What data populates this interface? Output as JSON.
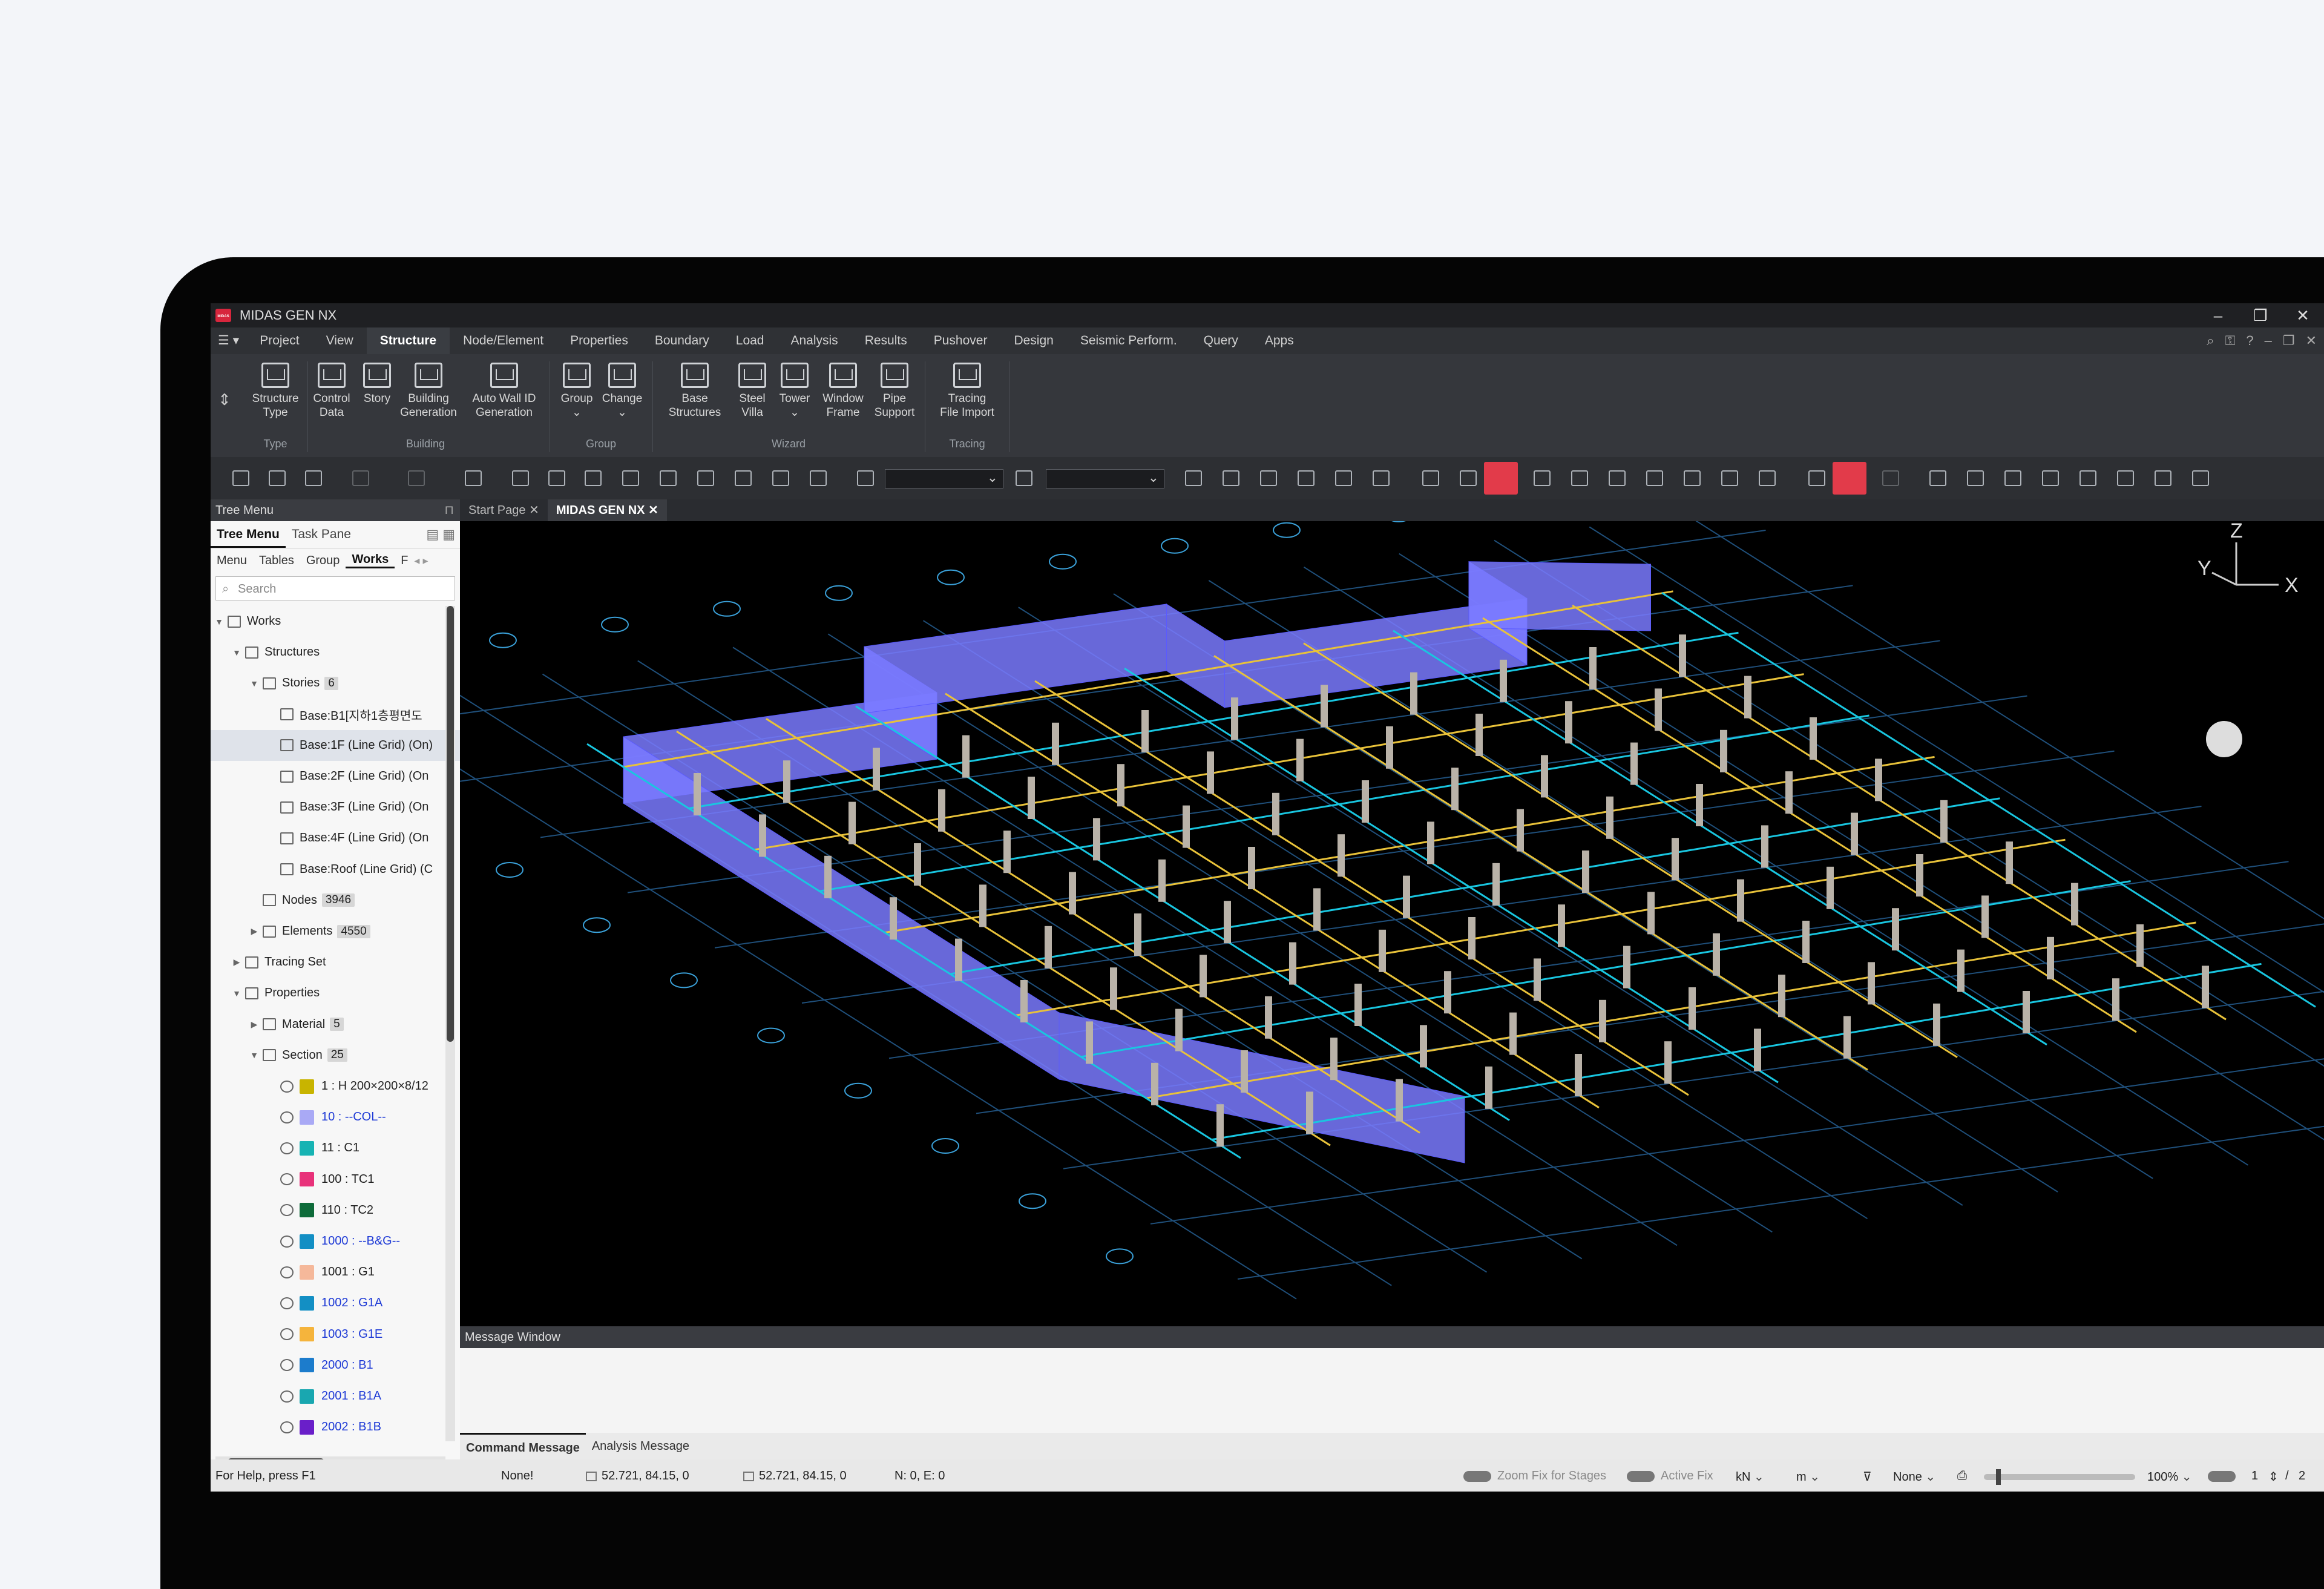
{
  "app": {
    "title": "MIDAS GEN NX",
    "logo_text": "MIDAS",
    "accent_color": "#e23b4a"
  },
  "menubar": {
    "items": [
      "Project",
      "View",
      "Structure",
      "Node/Element",
      "Properties",
      "Boundary",
      "Load",
      "Analysis",
      "Results",
      "Pushover",
      "Design",
      "Seismic Perform.",
      "Query",
      "Apps"
    ],
    "active": "Structure"
  },
  "ribbon": {
    "buttons": [
      {
        "label": "Structure\nType",
        "icon": "structure-type-icon"
      },
      {
        "label": "Control\nData",
        "icon": "control-data-icon"
      },
      {
        "label": "Story",
        "icon": "story-icon"
      },
      {
        "label": "Building\nGeneration",
        "icon": "building-generation-icon"
      },
      {
        "label": "Auto Wall ID\nGeneration",
        "icon": "auto-wall-id-icon"
      },
      {
        "label": "Group",
        "icon": "group-icon"
      },
      {
        "label": "Change",
        "icon": "change-icon"
      },
      {
        "label": "Base\nStructures",
        "icon": "base-structures-icon"
      },
      {
        "label": "Steel\nVilla",
        "icon": "steel-villa-icon"
      },
      {
        "label": "Tower",
        "icon": "tower-icon"
      },
      {
        "label": "Window\nFrame",
        "icon": "window-frame-icon"
      },
      {
        "label": "Pipe\nSupport",
        "icon": "pipe-support-icon"
      },
      {
        "label": "Tracing\nFile Import",
        "icon": "tracing-file-import-icon"
      }
    ],
    "groups": [
      "Type",
      "Building",
      "Group",
      "Wizard",
      "Tracing"
    ]
  },
  "tree_menu": {
    "header": "Tree Menu",
    "tabs": [
      "Tree Menu",
      "Task Pane"
    ],
    "subtabs": [
      "Menu",
      "Tables",
      "Group",
      "Works",
      "F"
    ],
    "active_subtab": "Works",
    "search_placeholder": "Search",
    "rows": [
      {
        "label": "Works",
        "indent": 0,
        "caret": "▼"
      },
      {
        "label": "Structures",
        "indent": 1,
        "caret": "▼"
      },
      {
        "label": "Stories",
        "indent": 2,
        "caret": "▼",
        "count": "6"
      },
      {
        "label": "Base:B1[지하1층평면도",
        "indent": 3
      },
      {
        "label": "Base:1F (Line Grid) (On)",
        "indent": 3,
        "selected": true
      },
      {
        "label": "Base:2F (Line Grid) (On",
        "indent": 3
      },
      {
        "label": "Base:3F (Line Grid) (On",
        "indent": 3
      },
      {
        "label": "Base:4F (Line Grid) (On",
        "indent": 3
      },
      {
        "label": "Base:Roof (Line Grid) (C",
        "indent": 3
      },
      {
        "label": "Nodes",
        "indent": 2,
        "count": "3946"
      },
      {
        "label": "Elements",
        "indent": 2,
        "caret": "▶",
        "count": "4550"
      },
      {
        "label": "Tracing Set",
        "indent": 1,
        "caret": "▶"
      },
      {
        "label": "Properties",
        "indent": 1,
        "caret": "▼"
      },
      {
        "label": "Material",
        "indent": 2,
        "caret": "▶",
        "count": "5"
      },
      {
        "label": "Section",
        "indent": 2,
        "caret": "▼",
        "count": "25"
      }
    ],
    "sections": [
      {
        "label": "1 : H 200×200×8/12",
        "color": "#c8b400",
        "blue": false
      },
      {
        "label": "10 : --COL--",
        "color": "#a9a9f5",
        "blue": true
      },
      {
        "label": "11 : C1",
        "color": "#17b3b3",
        "blue": false
      },
      {
        "label": "100 : TC1",
        "color": "#e8327a",
        "blue": false
      },
      {
        "label": "110 : TC2",
        "color": "#0e6b3a",
        "blue": false
      },
      {
        "label": "1000 : --B&G--",
        "color": "#138fc4",
        "blue": true
      },
      {
        "label": "1001 : G1",
        "color": "#f5b89a",
        "blue": false
      },
      {
        "label": "1002 : G1A",
        "color": "#138fc4",
        "blue": true
      },
      {
        "label": "1003 : G1E",
        "color": "#f5b43c",
        "blue": true
      },
      {
        "label": "2000 : B1",
        "color": "#1c7ccc",
        "blue": true
      },
      {
        "label": "2001 : B1A",
        "color": "#19a7b0",
        "blue": true
      },
      {
        "label": "2002 : B1B",
        "color": "#6a1fc9",
        "blue": true
      }
    ]
  },
  "doc_tabs": [
    "Start Page",
    "MIDAS GEN NX"
  ],
  "active_doc_tab": "MIDAS GEN NX",
  "viewport": {
    "axis_labels": {
      "x": "X",
      "y": "Y",
      "z": "Z"
    },
    "model_color": "#7a7aff",
    "background": "#000000"
  },
  "message_window": {
    "header": "Message Window",
    "tabs": [
      "Command Message",
      "Analysis Message"
    ],
    "active_tab": "Command Message"
  },
  "statusbar": {
    "help": "For Help, press F1",
    "state": "None!",
    "coord1": "52.721, 84.15, 0",
    "coord2": "52.721, 84.15, 0",
    "ne": "N: 0, E: 0",
    "zoom_fix": "Zoom Fix for Stages",
    "active_fix": "Active Fix",
    "force_unit": "kN",
    "length_unit": "m",
    "filter": "None",
    "zoom": "100%",
    "page": "1",
    "page_sep": "/",
    "page_total": "2"
  }
}
